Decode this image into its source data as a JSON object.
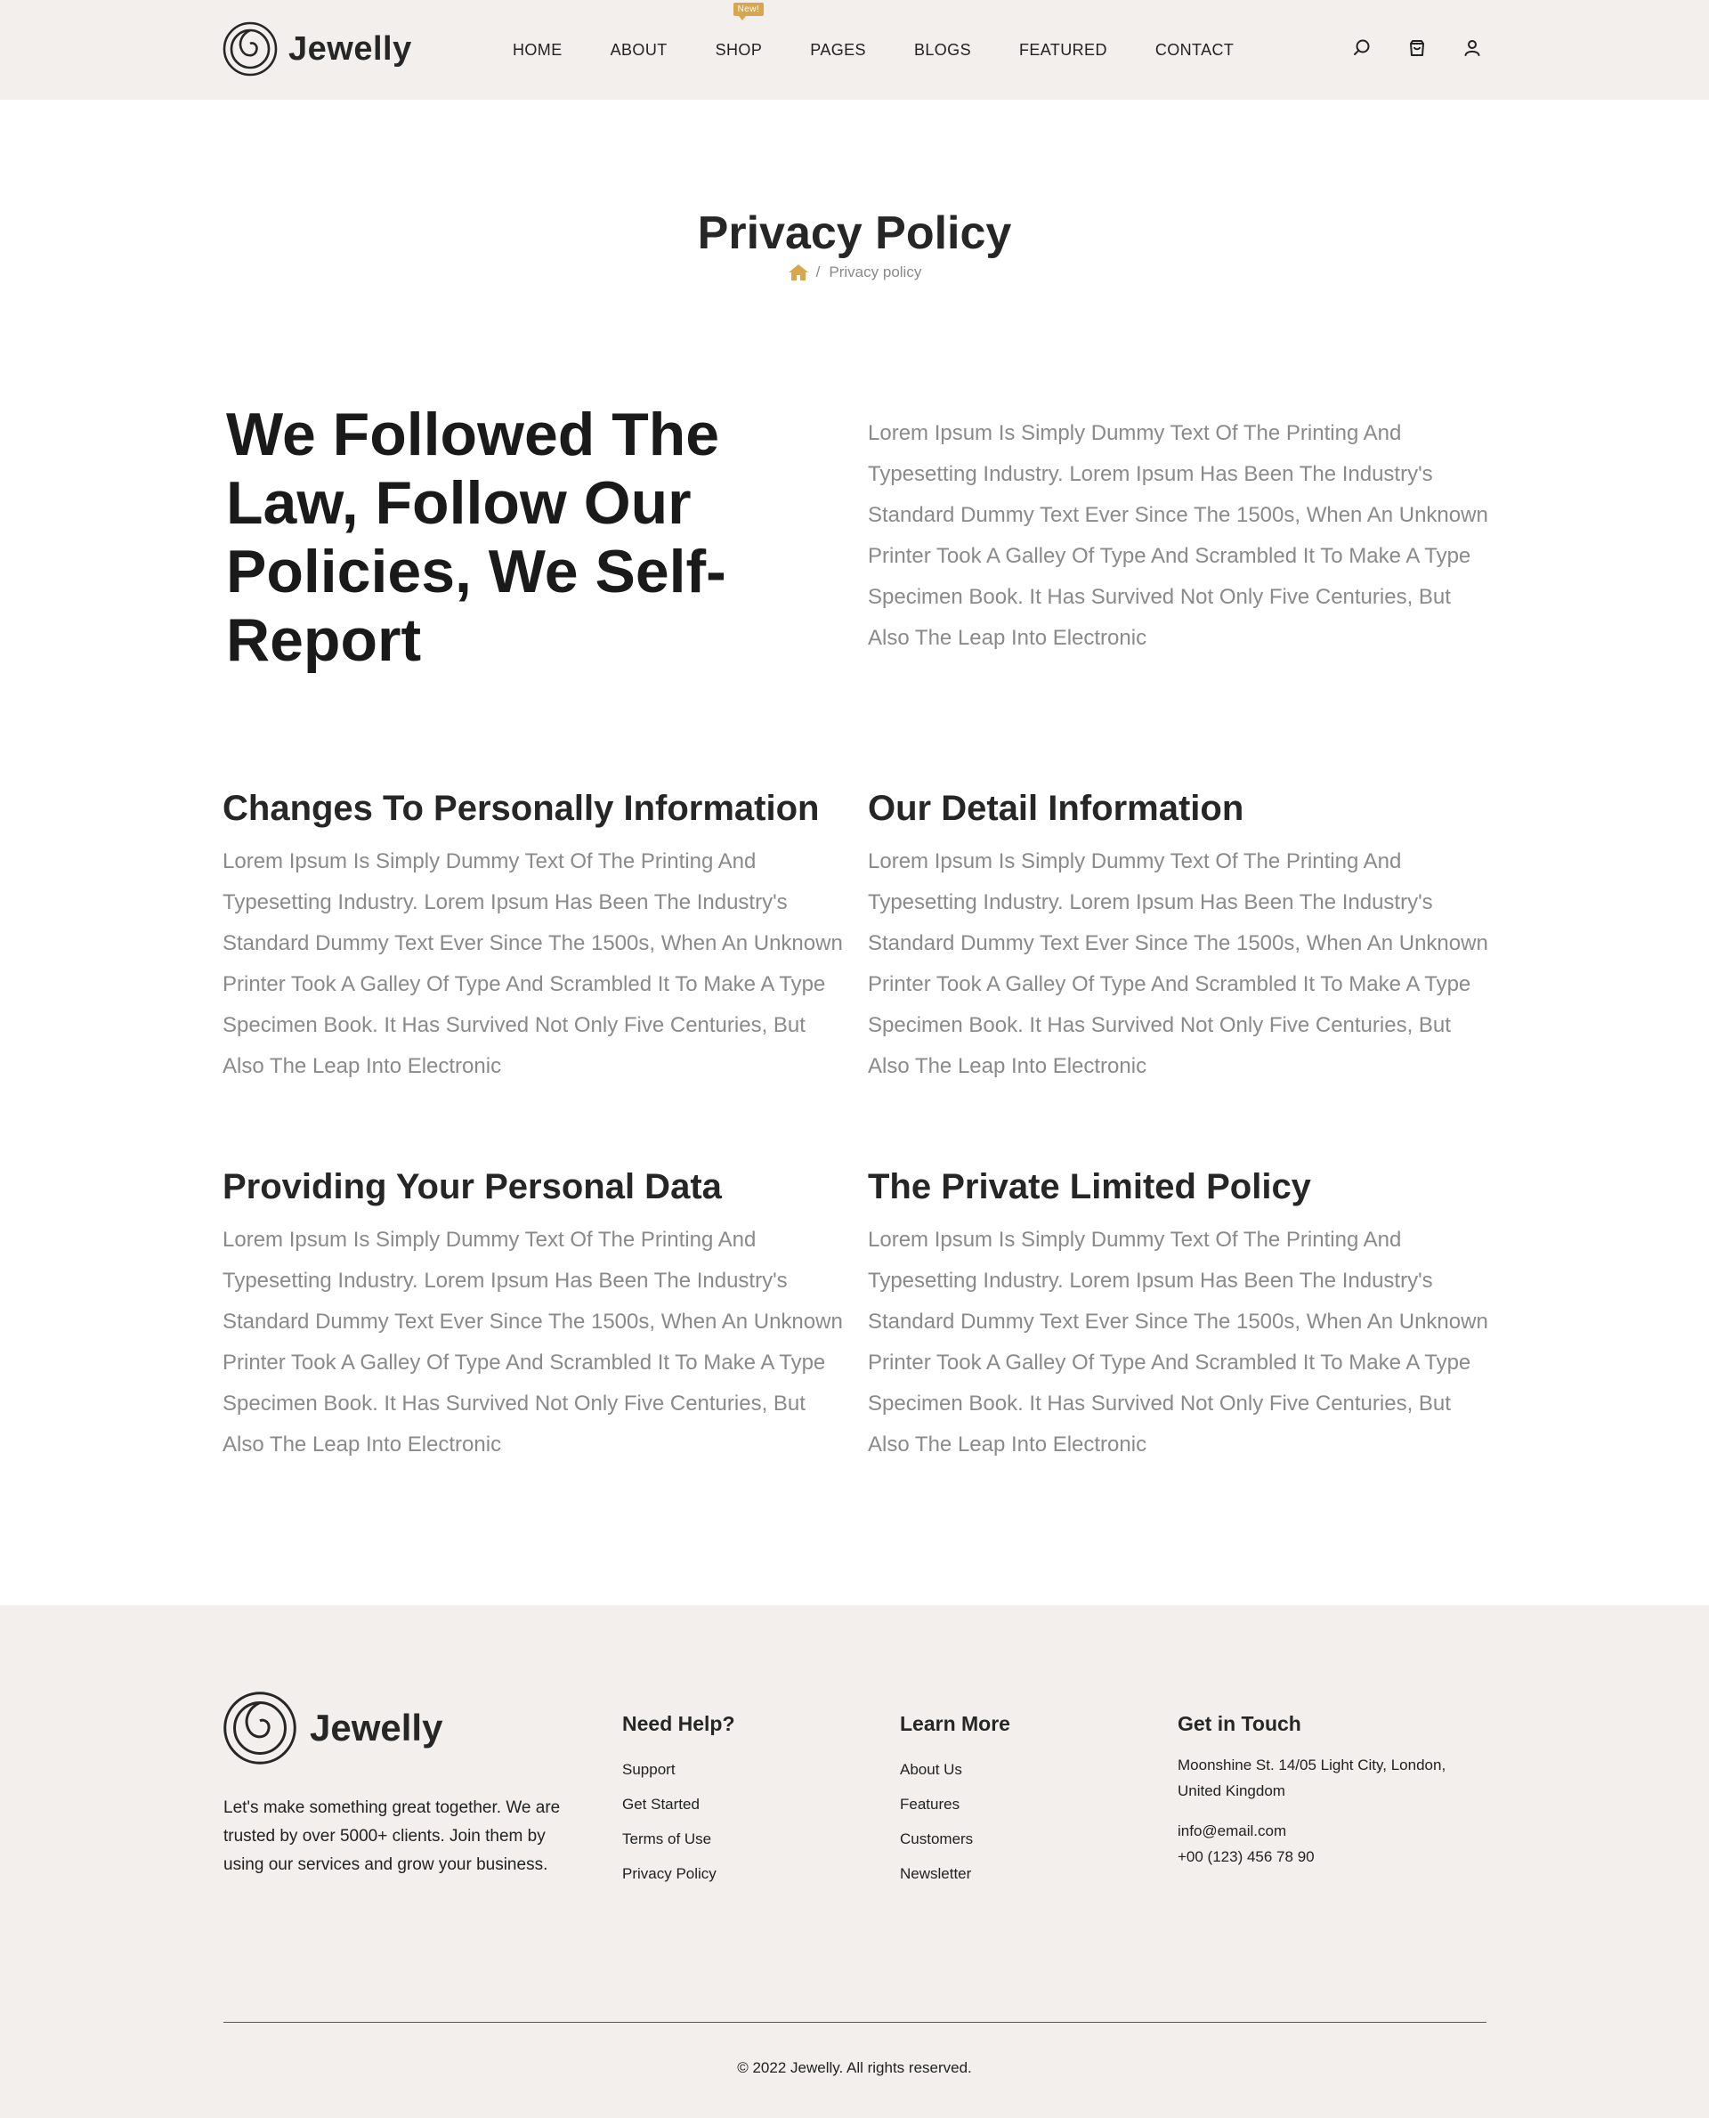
{
  "header": {
    "logo_text": "Jewelly",
    "nav": [
      {
        "label": "HOME"
      },
      {
        "label": "ABOUT"
      },
      {
        "label": "SHOP",
        "badge": "New!"
      },
      {
        "label": "PAGES"
      },
      {
        "label": "BLOGS"
      },
      {
        "label": "FEATURED"
      },
      {
        "label": "CONTACT"
      }
    ],
    "icons": [
      "search-icon",
      "cart-icon",
      "user-icon"
    ]
  },
  "page": {
    "title": "Privacy Policy",
    "breadcrumb": {
      "separator": "/",
      "current": "Privacy policy"
    }
  },
  "intro": {
    "heading": "We Followed The Law, Follow Our Policies, We Self-Report",
    "text": "Lorem Ipsum Is Simply Dummy Text Of The Printing And Typesetting Industry. Lorem Ipsum Has Been The Industry's Standard Dummy Text Ever Since The 1500s, When An Unknown Printer Took A Galley Of Type And Scrambled It To Make A Type Specimen Book. It Has Survived Not Only Five Centuries, But Also The Leap Into Electronic"
  },
  "sections": [
    {
      "title": "Changes To Personally Information",
      "text": "Lorem Ipsum Is Simply Dummy Text Of The Printing And Typesetting Industry. Lorem Ipsum Has Been The Industry's Standard Dummy Text Ever Since The 1500s, When An Unknown Printer Took A Galley Of Type And Scrambled It To Make A Type Specimen Book. It Has Survived Not Only Five Centuries, But Also The Leap Into Electronic"
    },
    {
      "title": "Our Detail Information",
      "text": "Lorem Ipsum Is Simply Dummy Text Of The Printing And Typesetting Industry. Lorem Ipsum Has Been The Industry's Standard Dummy Text Ever Since The 1500s, When An Unknown Printer Took A Galley Of Type And Scrambled It To Make A Type Specimen Book. It Has Survived Not Only Five Centuries, But Also The Leap Into Electronic"
    },
    {
      "title": "Providing Your Personal Data",
      "text": "Lorem Ipsum Is Simply Dummy Text Of The Printing And Typesetting Industry. Lorem Ipsum Has Been The Industry's Standard Dummy Text Ever Since The 1500s, When An Unknown Printer Took A Galley Of Type And Scrambled It To Make A Type Specimen Book. It Has Survived Not Only Five Centuries, But Also The Leap Into Electronic"
    },
    {
      "title": "The Private Limited Policy",
      "text": "Lorem Ipsum Is Simply Dummy Text Of The Printing And Typesetting Industry. Lorem Ipsum Has Been The Industry's Standard Dummy Text Ever Since The 1500s, When An Unknown Printer Took A Galley Of Type And Scrambled It To Make A Type Specimen Book. It Has Survived Not Only Five Centuries, But Also The Leap Into Electronic"
    }
  ],
  "footer": {
    "logo_text": "Jewelly",
    "about": "Let's make something great together. We are trusted by over 5000+ clients. Join them by using our services and grow your business.",
    "need_help": {
      "title": "Need Help?",
      "links": [
        "Support",
        "Get Started",
        "Terms of Use",
        "Privacy Policy"
      ]
    },
    "learn_more": {
      "title": "Learn More",
      "links": [
        "About Us",
        "Features",
        "Customers",
        "Newsletter"
      ]
    },
    "get_in_touch": {
      "title": "Get in Touch",
      "address": "Moonshine St. 14/05 Light City, London, United Kingdom",
      "email": "info@email.com",
      "phone": "+00 (123) 456 78 90"
    },
    "copyright": "© 2022 Jewelly. All rights reserved."
  },
  "colors": {
    "accent": "#d8a64d",
    "header_bg": "#f2efec",
    "text_muted": "#8a8a8a",
    "heading": "#262626"
  }
}
